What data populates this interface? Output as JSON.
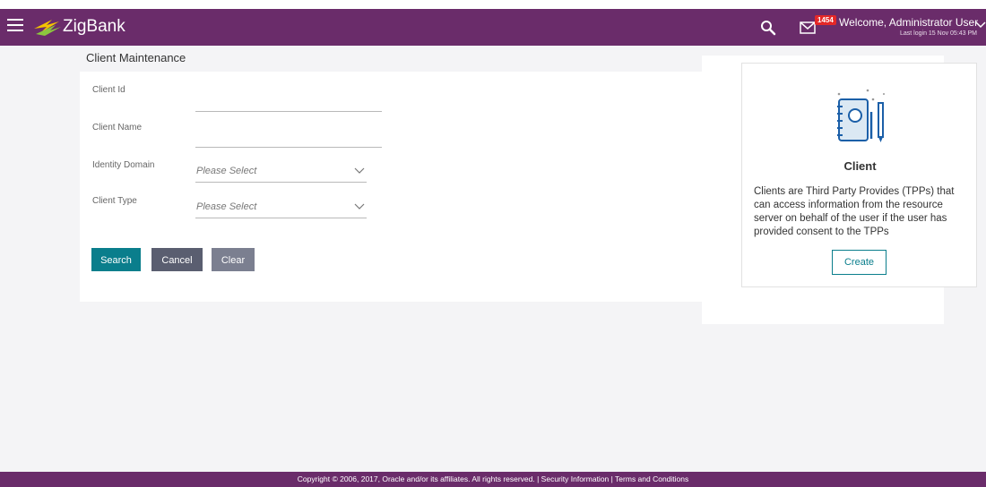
{
  "header": {
    "brand": "ZigBank",
    "notification_count": "1454",
    "welcome": "Welcome, Administrator User",
    "last_login": "Last login 15 Nov 05:43 PM",
    "color": "#6a2c6a"
  },
  "page": {
    "title": "Client Maintenance"
  },
  "form": {
    "client_id_label": "Client Id",
    "client_id_value": "",
    "client_name_label": "Client Name",
    "client_name_value": "",
    "identity_domain_label": "Identity Domain",
    "identity_domain_value": "Please Select",
    "client_type_label": "Client Type",
    "client_type_value": "Please Select"
  },
  "buttons": {
    "search": "Search",
    "cancel": "Cancel",
    "clear": "Clear"
  },
  "side_card": {
    "title": "Client",
    "description": "Clients are Third Party Provides (TPPs) that can access information from the resource server on behalf of the user if the user has provided consent to the TPPs",
    "create": "Create"
  },
  "footer": {
    "text": "Copyright © 2006, 2017, Oracle and/or its affiliates. All rights reserved. | Security Information | Terms and Conditions"
  },
  "colors": {
    "accent": "#0a7e8c",
    "cancel": "#5a5e70",
    "clear": "#7b7f90",
    "badge": "#e42828"
  },
  "icons": [
    "menu-icon",
    "zigbank-logo-icon",
    "search-icon",
    "mail-icon",
    "chevron-down-icon",
    "client-notebook-icon"
  ]
}
